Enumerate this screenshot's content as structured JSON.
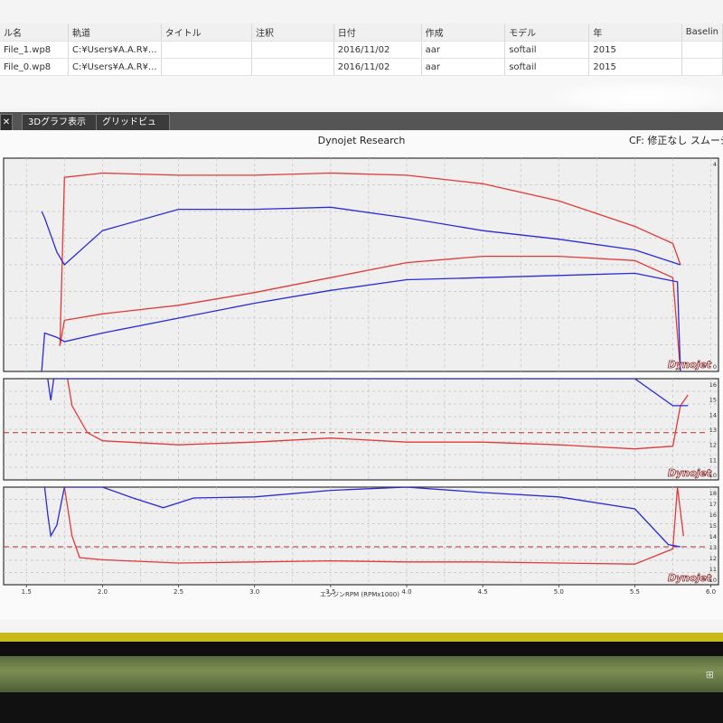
{
  "file_table": {
    "columns": [
      "ル名",
      "軌道",
      "タイトル",
      "注釈",
      "日付",
      "作成",
      "モデル",
      "年",
      "Baselin"
    ],
    "rows": [
      [
        "File_1.wp8",
        "C:¥Users¥A.A.R¥...",
        "",
        "",
        "2016/11/02",
        "aar",
        "softail",
        "2015",
        ""
      ],
      [
        "File_0.wp8",
        "C:¥Users¥A.A.R¥...",
        "",
        "",
        "2016/11/02",
        "aar",
        "softail",
        "2015",
        ""
      ]
    ]
  },
  "tabs": {
    "close_label": "✕",
    "tab_3d": "3Dグラフ表示",
    "tab_grid": "グリッドビュー"
  },
  "graph": {
    "title": "Dynojet Research",
    "cf_label": "CF: 修正なし スムージン",
    "logo": "Dynojet",
    "x_axis_label": "エンジンRPM (RPMx1000)"
  },
  "chart_data": [
    {
      "type": "line",
      "panel": "power-torque",
      "x_ticks": [
        "1.5",
        "2.0",
        "2.5",
        "3.0",
        "3.5",
        "4.0",
        "4.5",
        "5.0",
        "5.5",
        "6.0"
      ],
      "xlim": [
        1.35,
        6.05
      ],
      "y_right_ticks": [
        "4",
        "0"
      ],
      "series": [
        {
          "color": "#e03a3a",
          "x": [
            1.72,
            1.75,
            2.0,
            2.5,
            3.0,
            3.5,
            4.0,
            4.5,
            5.0,
            5.5,
            5.75,
            5.8
          ],
          "y": [
            12,
            91,
            93,
            92,
            92,
            93,
            92,
            88,
            80,
            68,
            60,
            50
          ]
        },
        {
          "color": "#2a2ad6",
          "x": [
            1.6,
            1.62,
            1.7,
            1.75,
            2.0,
            2.5,
            3.0,
            3.5,
            4.0,
            4.5,
            5.0,
            5.5,
            5.8
          ],
          "y": [
            75,
            72,
            56,
            50,
            66,
            76,
            76,
            77,
            72,
            66,
            62,
            57,
            50
          ]
        },
        {
          "color": "#e03a3a",
          "x": [
            1.72,
            1.75,
            2.0,
            2.5,
            3.0,
            3.5,
            4.0,
            4.5,
            5.0,
            5.5,
            5.75,
            5.8
          ],
          "y": [
            12,
            24,
            27,
            31,
            37,
            44,
            51,
            54,
            54,
            52,
            44,
            0
          ]
        },
        {
          "color": "#2a2ad6",
          "x": [
            1.6,
            1.62,
            1.7,
            1.75,
            2.0,
            2.5,
            3.0,
            3.5,
            4.0,
            4.5,
            5.0,
            5.5,
            5.78,
            5.8
          ],
          "y": [
            0,
            18,
            16,
            14,
            18,
            25,
            32,
            38,
            43,
            44,
            45,
            46,
            42,
            0
          ]
        }
      ]
    },
    {
      "type": "line",
      "panel": "afr-1",
      "x_ticks": [],
      "xlim": [
        1.35,
        6.05
      ],
      "y_right_ticks": [
        "16",
        "15",
        "14",
        "13",
        "12",
        "11",
        "10"
      ],
      "ylim": [
        9.5,
        17
      ],
      "reference_line": 13,
      "series": [
        {
          "color": "#e03a3a",
          "x": [
            1.77,
            1.8,
            1.9,
            2.0,
            2.5,
            3.0,
            3.5,
            4.0,
            4.5,
            5.0,
            5.5,
            5.75,
            5.8,
            5.85
          ],
          "y": [
            17,
            15,
            13,
            12.4,
            12.1,
            12.3,
            12.6,
            12.3,
            12.3,
            12.1,
            11.8,
            12,
            15,
            15.8
          ]
        },
        {
          "color": "#2a2ad6",
          "x": [
            1.64,
            1.66,
            1.68,
            5.5,
            5.75,
            5.85
          ],
          "y": [
            17,
            15.4,
            17,
            17,
            15,
            15
          ]
        }
      ]
    },
    {
      "type": "line",
      "panel": "afr-2",
      "x_ticks": [],
      "xlim": [
        1.35,
        6.05
      ],
      "y_right_ticks": [
        "18",
        "17",
        "16",
        "15",
        "14",
        "13",
        "12",
        "11",
        "10"
      ],
      "ylim": [
        9.5,
        18.5
      ],
      "reference_line": 13,
      "series": [
        {
          "color": "#e03a3a",
          "x": [
            1.75,
            1.8,
            1.85,
            2.0,
            2.5,
            3.0,
            3.5,
            4.0,
            4.5,
            5.0,
            5.5,
            5.75,
            5.78,
            5.82
          ],
          "y": [
            18.5,
            14,
            12,
            11.8,
            11.5,
            11.6,
            11.7,
            11.6,
            11.6,
            11.5,
            11.4,
            12.8,
            18.5,
            14
          ]
        },
        {
          "color": "#2a2ad6",
          "x": [
            1.62,
            1.64,
            1.66,
            1.7,
            1.75,
            2.0,
            2.2,
            2.4,
            2.6,
            3.0,
            3.5,
            4.0,
            4.5,
            5.0,
            5.5,
            5.72,
            5.8
          ],
          "y": [
            18.5,
            16,
            14,
            15,
            18.5,
            18.5,
            17.5,
            16.6,
            17.5,
            17.6,
            18.2,
            18.5,
            18,
            17.6,
            16.5,
            13.2,
            13
          ]
        }
      ]
    }
  ]
}
